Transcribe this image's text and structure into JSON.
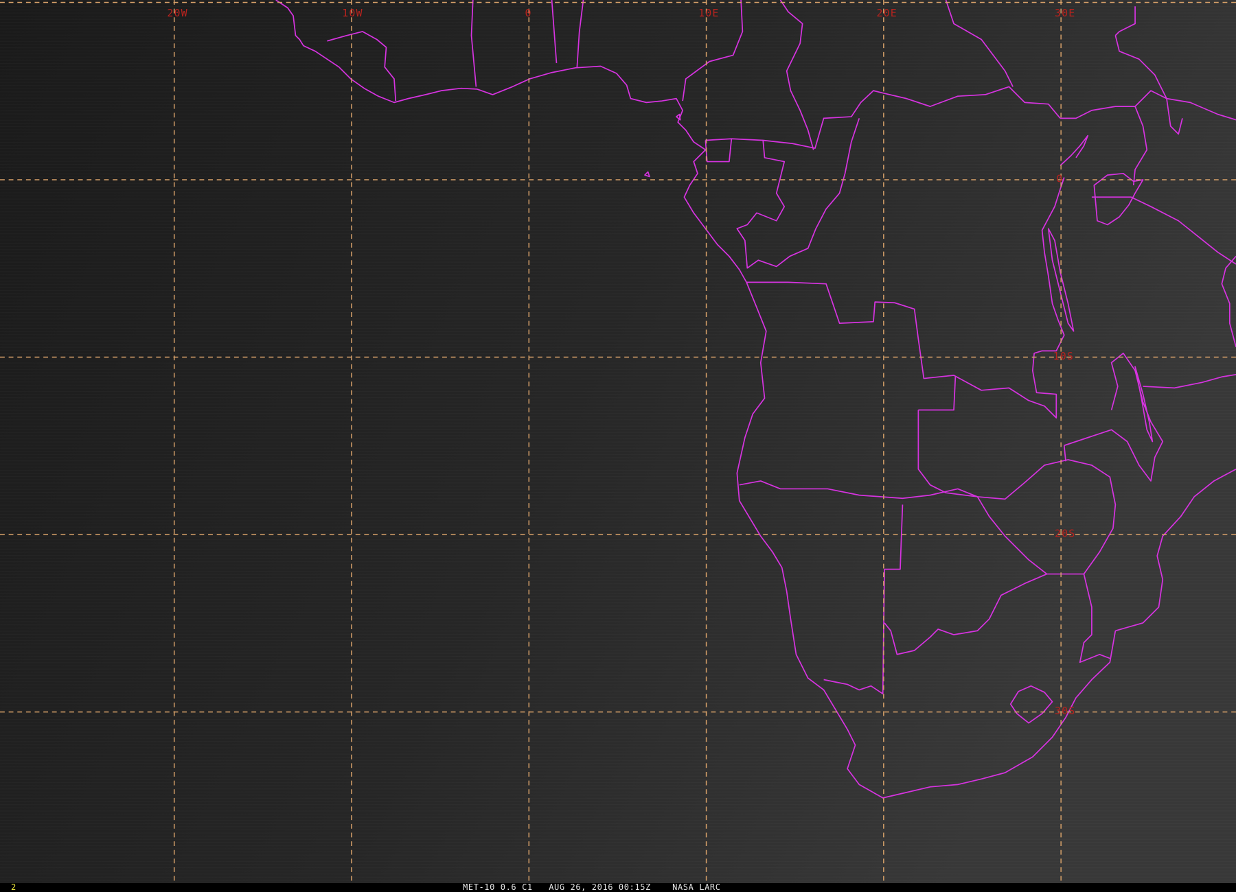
{
  "colors": {
    "background": "#000000",
    "image_dark": "#1b1b1b",
    "image_light": "#3a3a3a",
    "grid": "#d9a26a",
    "grid_label": "#b8231e",
    "borders": "#d633e0",
    "frame_number": "#e8e23a",
    "caption": "#e6e6e6"
  },
  "grid": {
    "meridian_labels": [
      "20W",
      "10W",
      "0",
      "10E",
      "20E",
      "30E"
    ],
    "parallel_labels": [
      "0",
      "10S",
      "20S",
      "30S"
    ]
  },
  "status_bar": {
    "frame_number": "2",
    "caption": "MET-10 0.6 C1   AUG 26, 2016 00:15Z    NASA LARC"
  }
}
